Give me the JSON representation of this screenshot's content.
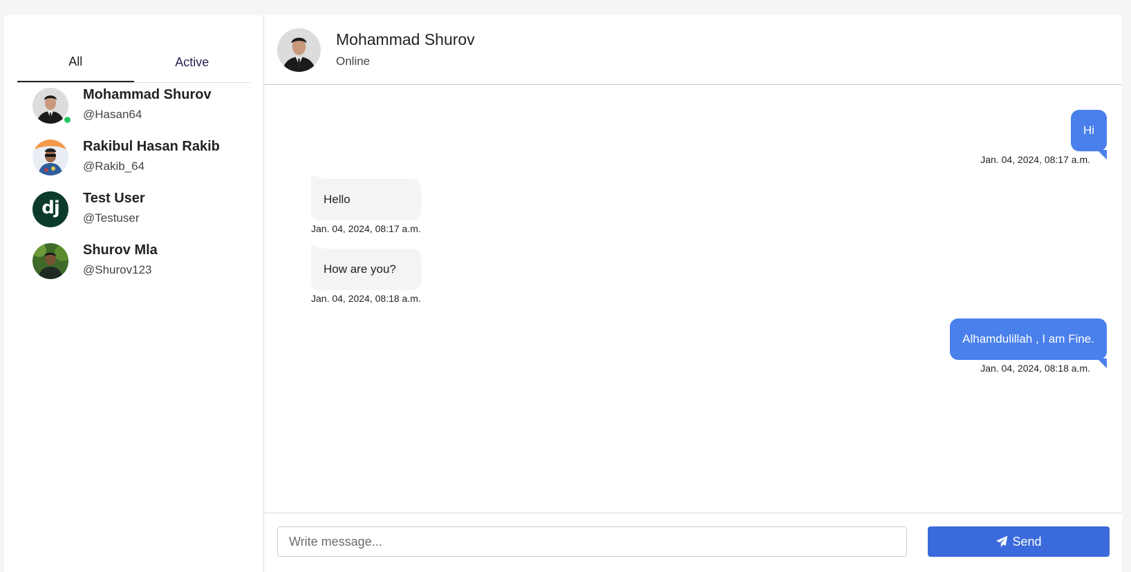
{
  "sidebar": {
    "tabs": [
      {
        "label": "All"
      },
      {
        "label": "Active"
      }
    ],
    "contacts": [
      {
        "name": "Mohammad Shurov",
        "handle": "@Hasan64",
        "online": true
      },
      {
        "name": "Rakibul Hasan Rakib",
        "handle": "@Rakib_64",
        "online": false
      },
      {
        "name": "Test User",
        "handle": "@Testuser",
        "online": false,
        "avatar_text": "dj"
      },
      {
        "name": "Shurov Mla",
        "handle": "@Shurov123",
        "online": false
      }
    ]
  },
  "chat": {
    "header": {
      "name": "Mohammad Shurov",
      "status": "Online"
    },
    "messages": [
      {
        "direction": "out",
        "text": "Hi",
        "time": "Jan. 04, 2024, 08:17 a.m."
      },
      {
        "direction": "in",
        "text": "Hello",
        "time": "Jan. 04, 2024, 08:17 a.m."
      },
      {
        "direction": "in",
        "text": "How are you?",
        "time": "Jan. 04, 2024, 08:18 a.m."
      },
      {
        "direction": "out",
        "text": "Alhamdulillah , I am Fine.",
        "time": "Jan. 04, 2024, 08:18 a.m."
      }
    ],
    "composer": {
      "placeholder": "Write message...",
      "send_label": "Send"
    }
  },
  "colors": {
    "outgoing_bubble": "#4a80eb",
    "incoming_bubble": "#f4f4f4",
    "send_button": "#3a6adb",
    "online_dot": "#20c763"
  }
}
